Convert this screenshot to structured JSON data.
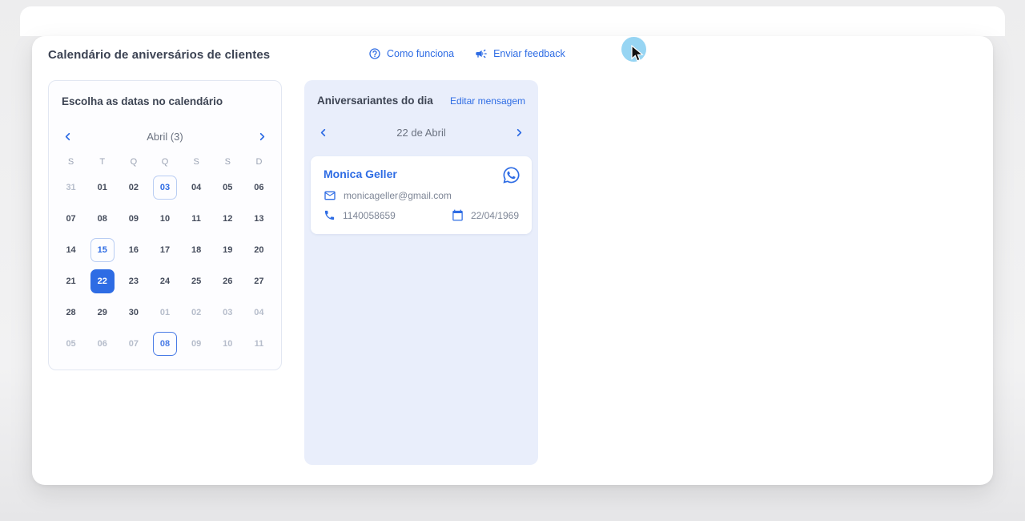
{
  "header": {
    "title": "Calendário de aniversários de clientes",
    "how_it_works_label": "Como funciona",
    "send_feedback_label": "Enviar feedback"
  },
  "calendar_panel": {
    "title": "Escolha as datas no calendário",
    "month_label": "Abril (3)",
    "weekdays": [
      "S",
      "T",
      "Q",
      "Q",
      "S",
      "S",
      "D"
    ],
    "days": [
      {
        "label": "31",
        "state": "muted"
      },
      {
        "label": "01",
        "state": "normal"
      },
      {
        "label": "02",
        "state": "normal"
      },
      {
        "label": "03",
        "state": "marked"
      },
      {
        "label": "04",
        "state": "normal"
      },
      {
        "label": "05",
        "state": "normal"
      },
      {
        "label": "06",
        "state": "normal"
      },
      {
        "label": "07",
        "state": "normal"
      },
      {
        "label": "08",
        "state": "normal"
      },
      {
        "label": "09",
        "state": "normal"
      },
      {
        "label": "10",
        "state": "normal"
      },
      {
        "label": "11",
        "state": "normal"
      },
      {
        "label": "12",
        "state": "normal"
      },
      {
        "label": "13",
        "state": "normal"
      },
      {
        "label": "14",
        "state": "normal"
      },
      {
        "label": "15",
        "state": "marked"
      },
      {
        "label": "16",
        "state": "normal"
      },
      {
        "label": "17",
        "state": "normal"
      },
      {
        "label": "18",
        "state": "normal"
      },
      {
        "label": "19",
        "state": "normal"
      },
      {
        "label": "20",
        "state": "normal"
      },
      {
        "label": "21",
        "state": "normal"
      },
      {
        "label": "22",
        "state": "selected"
      },
      {
        "label": "23",
        "state": "normal"
      },
      {
        "label": "24",
        "state": "normal"
      },
      {
        "label": "25",
        "state": "normal"
      },
      {
        "label": "26",
        "state": "normal"
      },
      {
        "label": "27",
        "state": "normal"
      },
      {
        "label": "28",
        "state": "normal"
      },
      {
        "label": "29",
        "state": "normal"
      },
      {
        "label": "30",
        "state": "normal"
      },
      {
        "label": "01",
        "state": "muted"
      },
      {
        "label": "02",
        "state": "muted"
      },
      {
        "label": "03",
        "state": "muted"
      },
      {
        "label": "04",
        "state": "muted"
      },
      {
        "label": "05",
        "state": "muted"
      },
      {
        "label": "06",
        "state": "muted"
      },
      {
        "label": "07",
        "state": "muted"
      },
      {
        "label": "08",
        "state": "marked-strong"
      },
      {
        "label": "09",
        "state": "muted"
      },
      {
        "label": "10",
        "state": "muted"
      },
      {
        "label": "11",
        "state": "muted"
      }
    ]
  },
  "birthdays_panel": {
    "title": "Aniversariantes do dia",
    "edit_message_label": "Editar mensagem",
    "day_label": "22 de Abril",
    "contact": {
      "name": "Monica Geller",
      "email": "monicageller@gmail.com",
      "phone": "1140058659",
      "birthdate": "22/04/1969"
    }
  },
  "icons": {
    "help": "question-circle-icon",
    "feedback": "megaphone-icon",
    "prev": "chevron-left-icon",
    "next": "chevron-right-icon",
    "whatsapp": "whatsapp-icon",
    "email": "envelope-icon",
    "phone": "phone-icon",
    "birthday": "calendar-icon"
  },
  "colors": {
    "accent": "#2e6ce4",
    "selected_day_bg": "#2e6ce4",
    "panel_bg": "#e9eefb",
    "highlight_circle": "#8ed1f2",
    "title_text": "#3c4353",
    "muted_day": "#b6bdcb"
  }
}
